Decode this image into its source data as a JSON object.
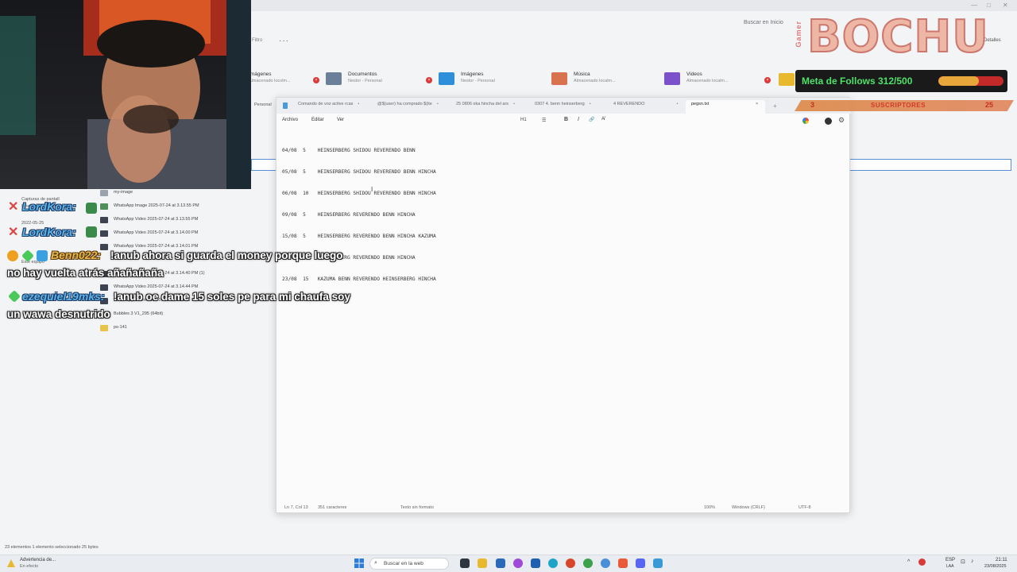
{
  "explorer": {
    "search_placeholder": "Buscar en Inicio",
    "filter_label": "Filtro",
    "more_label": "···",
    "details_label": "Detalles",
    "quick_access": [
      {
        "name": "Imágenes",
        "sub": "Almacenado locolm...",
        "color": "#3b82c4"
      },
      {
        "name": "Documentos",
        "sub": "Nestor - Personal",
        "color": "#6b7f99"
      },
      {
        "name": "Imágenes",
        "sub": "Nestor - Personal",
        "color": "#2f8fd8"
      },
      {
        "name": "Música",
        "sub": "Almacenado localm...",
        "color": "#d9734f"
      },
      {
        "name": "Videos",
        "sub": "Almacenado localm...",
        "color": "#7b52c9"
      }
    ],
    "left_pane": [
      "Capturas de pantall",
      "Nestor - Personal",
      "2022-05-25",
      "Este equipo",
      "Personal"
    ],
    "files": [
      "my-image",
      "WhatsApp Image 2025-07-24 at 3.13.55 PM",
      "WhatsApp Video 2025-07-24 at 3.13.55 PM",
      "WhatsApp Video 2025-07-24 at 3.14.00 PM",
      "WhatsApp Video 2025-07-24 at 3.14.01 PM",
      "WhatsApp Video 2025-07-24 at 3.14.40 PM (1)",
      "WhatsApp Video 2025-07-24 at 3.14.44 PM",
      "WhatsApp Video 2025-07-24 at 3.14.46 PM",
      "Bubbles 3 V1_295 (64bit)",
      "ps-141"
    ],
    "status": "23 elementos     1 elemento seleccionado 25 bytes"
  },
  "notepad": {
    "tabs": [
      "Comando de voz active rcas",
      "@$(user) ha comprado $(ite",
      "25   0806 oka hincha del ars",
      "0307   4. benn heinserberg",
      "4   REVERENDO",
      "pegsn.txt"
    ],
    "menu": {
      "archivo": "Archivo",
      "editar": "Editar",
      "ver": "Ver"
    },
    "format": {
      "heading": "H1",
      "list": "☰",
      "bold": "B",
      "italic": "I",
      "link": "🔗",
      "clear": "A̸"
    },
    "lines": [
      "04/08  5    HEINSERBERG SHIDOU REVERENDO BENN",
      "05/08  5    HEINSERBERG SHIDOU REVERENDO BENN HINCHA",
      "06/08  10   HEINSERBERG SHIDOU REVERENDO BENN HINCHA",
      "09/08  5    HEINSERBERG REVERENDO BENN HINCHA",
      "15/08  5    HEINSERBERG REVERENDO BENN HINCHA KAZUMA",
      "20/08  35   HEINSERBERG REVERENDO BENN HINCHA",
      "23/08  15   KAZUMA BENN REVERENDO HEINSERBERG HINCHA"
    ],
    "status": {
      "position": "Ln 7, Col 13",
      "chars": "351 caracteres",
      "format": "Texto sin formato",
      "zoom": "100%",
      "eol": "Windows (CRLF)",
      "encoding": "UTF-8"
    }
  },
  "overlay": {
    "brand_side": "Gamer",
    "brand": "BOCHU",
    "goal_text": "Meta de Follows 312/500",
    "goal_current": 312,
    "goal_target": 500,
    "subs_left": "3",
    "subs_label": "SUSCRIPTORES",
    "subs_right": "25"
  },
  "chat": [
    {
      "user": "LordKora:",
      "message": ""
    },
    {
      "user": "LordKora:",
      "message": ""
    },
    {
      "user": "Benn022:",
      "message": "!anub ahora si guarda el money porque luego",
      "continuation": "no hay vuelta atrás añañañaña"
    },
    {
      "user": "ezequiel19mks:",
      "message": "!anub oe dame 15 soles pe para mi chaufa soy",
      "continuation": "un wawa desnutrido"
    }
  ],
  "taskbar": {
    "weather_title": "Advertencia de...",
    "weather_sub": "En efecto",
    "search_placeholder": "Buscar en la web",
    "lang": "ESP",
    "lang_sub": "LAA",
    "time": "21:11",
    "date": "23/08/2025"
  },
  "colors": {
    "accent": "#4de26a",
    "goal_fill": "#e8a73a",
    "goal_bg": "#c42a2a",
    "chat_name": "#5ab4e8"
  }
}
